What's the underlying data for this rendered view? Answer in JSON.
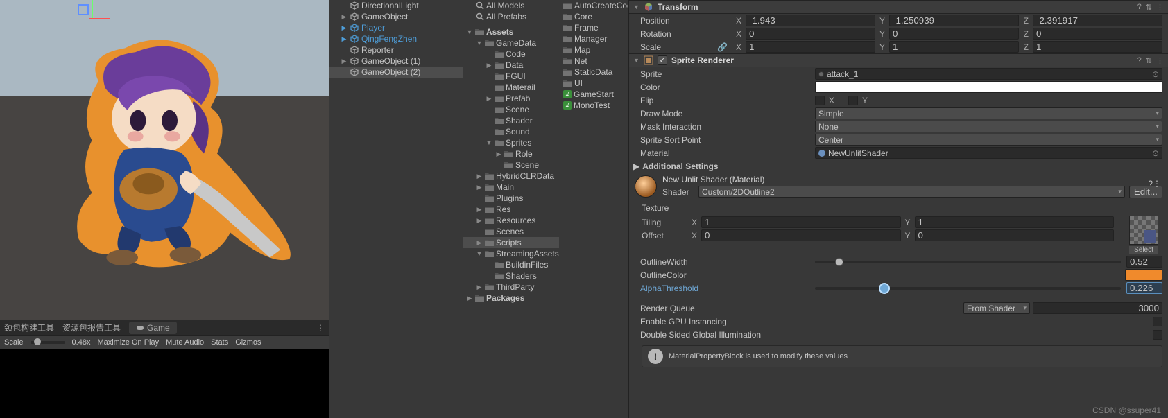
{
  "hierarchy": {
    "items": [
      {
        "name": "DirectionalLight",
        "blue": false,
        "fold": ""
      },
      {
        "name": "GameObject",
        "blue": false,
        "fold": "▶"
      },
      {
        "name": "Player",
        "blue": true,
        "fold": "▶"
      },
      {
        "name": "QingFengZhen",
        "blue": true,
        "fold": "▶"
      },
      {
        "name": "Reporter",
        "blue": false,
        "fold": ""
      },
      {
        "name": "GameObject (1)",
        "blue": false,
        "fold": "▶"
      },
      {
        "name": "GameObject (2)",
        "blue": false,
        "fold": "",
        "sel": true
      }
    ]
  },
  "project": {
    "top_items": [
      {
        "label": "All Models"
      },
      {
        "label": "All Prefabs",
        "icon": "search"
      }
    ],
    "root": "Assets",
    "tree": [
      {
        "label": "GameData",
        "d": 2,
        "fold": "▼"
      },
      {
        "label": "Code",
        "d": 3,
        "folder": true
      },
      {
        "label": "Data",
        "d": 3,
        "fold": "▶"
      },
      {
        "label": "FGUI",
        "d": 3,
        "folder": true
      },
      {
        "label": "Materail",
        "d": 3,
        "folder": true
      },
      {
        "label": "Prefab",
        "d": 3,
        "fold": "▶"
      },
      {
        "label": "Scene",
        "d": 3,
        "folder": true
      },
      {
        "label": "Shader",
        "d": 3,
        "folder": true
      },
      {
        "label": "Sound",
        "d": 3,
        "folder": true
      },
      {
        "label": "Sprites",
        "d": 3,
        "fold": "▼"
      },
      {
        "label": "Role",
        "d": 4,
        "fold": "▶"
      },
      {
        "label": "Scene",
        "d": 4,
        "folder": true
      },
      {
        "label": "HybridCLRData",
        "d": 2,
        "fold": "▶"
      },
      {
        "label": "Main",
        "d": 2,
        "fold": "▶"
      },
      {
        "label": "Plugins",
        "d": 2,
        "folder": true
      },
      {
        "label": "Res",
        "d": 2,
        "fold": "▶"
      },
      {
        "label": "Resources",
        "d": 2,
        "fold": "▶"
      },
      {
        "label": "Scenes",
        "d": 2,
        "folder": true
      },
      {
        "label": "Scripts",
        "d": 2,
        "fold": "▶",
        "sel": true
      },
      {
        "label": "StreamingAssets",
        "d": 2,
        "fold": "▼"
      },
      {
        "label": "BuildinFiles",
        "d": 3,
        "folder": true
      },
      {
        "label": "Shaders",
        "d": 3,
        "folder": true
      },
      {
        "label": "ThirdParty",
        "d": 2,
        "fold": "▶"
      }
    ],
    "packages": "Packages"
  },
  "items_panel": [
    {
      "label": "AutoCreateCode",
      "folder": true
    },
    {
      "label": "Core",
      "folder": true
    },
    {
      "label": "Frame",
      "folder": true
    },
    {
      "label": "Manager",
      "folder": true
    },
    {
      "label": "Map",
      "folder": true
    },
    {
      "label": "Net",
      "folder": true
    },
    {
      "label": "StaticData",
      "folder": true
    },
    {
      "label": "UI",
      "folder": true
    },
    {
      "label": "GameStart",
      "folder": false
    },
    {
      "label": "MonoTest",
      "folder": false
    }
  ],
  "scene_tabs": {
    "t1": "颈包构建工具",
    "t2": "资源包报告工具",
    "t3": "Game"
  },
  "scene_toolbar": {
    "scale": "Scale",
    "zoom": "0.48x",
    "maximize": "Maximize On Play",
    "mute": "Mute Audio",
    "stats": "Stats",
    "gizmos": "Gizmos"
  },
  "inspector": {
    "transform": {
      "title": "Transform",
      "position": {
        "label": "Position",
        "x": "-1.943",
        "y": "-1.250939",
        "z": "-2.391917"
      },
      "rotation": {
        "label": "Rotation",
        "x": "0",
        "y": "0",
        "z": "0"
      },
      "scale": {
        "label": "Scale",
        "x": "1",
        "y": "1",
        "z": "1"
      }
    },
    "sprite_renderer": {
      "title": "Sprite Renderer",
      "sprite_label": "Sprite",
      "sprite_val": "attack_1",
      "color_label": "Color",
      "flip_label": "Flip",
      "flip_x": "X",
      "flip_y": "Y",
      "drawmode_label": "Draw Mode",
      "drawmode_val": "Simple",
      "mask_label": "Mask Interaction",
      "mask_val": "None",
      "sort_label": "Sprite Sort Point",
      "sort_val": "Center",
      "material_label": "Material",
      "material_val": "NewUnlitShader",
      "additional": "Additional Settings"
    },
    "material": {
      "name": "New Unlit Shader (Material)",
      "shader_label": "Shader",
      "shader_val": "Custom/2DOutline2",
      "edit": "Edit...",
      "texture_label": "Texture",
      "tiling_label": "Tiling",
      "tiling_x": "1",
      "tiling_y": "1",
      "offset_label": "Offset",
      "offset_x": "0",
      "offset_y": "0",
      "tex_select": "Select",
      "outline_w_label": "OutlineWidth",
      "outline_w_val": "0.52",
      "outline_w_pct": 8,
      "outline_c_label": "OutlineColor",
      "alpha_label": "AlphaThreshold",
      "alpha_val": "0.226",
      "alpha_pct": 22.6,
      "rq_label": "Render Queue",
      "rq_mode": "From Shader",
      "rq_val": "3000",
      "gpu_label": "Enable GPU Instancing",
      "dsgi_label": "Double Sided Global Illumination",
      "info": "MaterialPropertyBlock is used to modify these values"
    }
  },
  "watermark": "CSDN @ssuper41"
}
